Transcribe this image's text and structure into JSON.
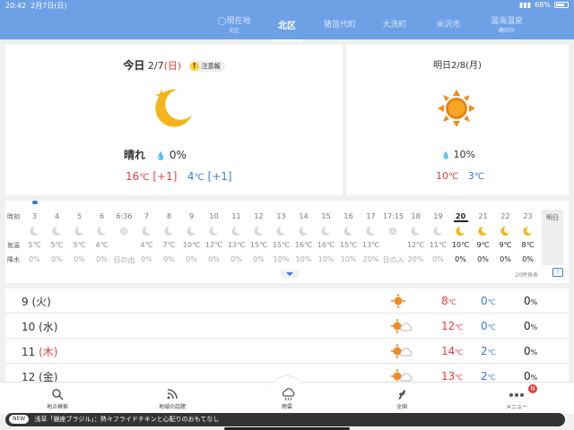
{
  "status": {
    "time": "20:42",
    "date": "2月7日(日)",
    "battery": "68%"
  },
  "locations": [
    {
      "label": "◯現在地",
      "sub": "北区"
    },
    {
      "label": "北区",
      "sub": ""
    },
    {
      "label": "猪苗代町",
      "sub": ""
    },
    {
      "label": "大洗町",
      "sub": ""
    },
    {
      "label": "米沢市",
      "sub": ""
    },
    {
      "label": "温海温泉",
      "sub": "鶴岡市"
    }
  ],
  "today": {
    "label": "今日",
    "date": "2/7",
    "dow": "(日)",
    "warning": "注意報",
    "condition": "晴れ",
    "rain": "0%",
    "high": "16",
    "high_diff": "[+1]",
    "low": "4",
    "low_diff": "[+1]",
    "unit": "℃"
  },
  "tomorrow": {
    "label": "明日2/8(月)",
    "rain": "10%",
    "high": "10",
    "low": "3",
    "unit": "℃"
  },
  "hourly_labels": {
    "hour": "時刻",
    "temp": "気温",
    "rain": "降水"
  },
  "hourly": [
    {
      "h": "3",
      "t": "5℃",
      "r": "0%",
      "icon": "moon-icon"
    },
    {
      "h": "4",
      "t": "5℃",
      "r": "0%",
      "icon": "moon-icon"
    },
    {
      "h": "5",
      "t": "5℃",
      "r": "0%",
      "icon": "moon-icon"
    },
    {
      "h": "6",
      "t": "4℃",
      "r": "0%",
      "icon": "moon-icon"
    },
    {
      "h": "6:36",
      "t": "",
      "r": "日の出",
      "icon": "sunrise-icon"
    },
    {
      "h": "7",
      "t": "4℃",
      "r": "0%",
      "icon": "moon-icon"
    },
    {
      "h": "8",
      "t": "7℃",
      "r": "0%",
      "icon": "moon-icon"
    },
    {
      "h": "9",
      "t": "10℃",
      "r": "0%",
      "icon": "moon-icon"
    },
    {
      "h": "10",
      "t": "12℃",
      "r": "0%",
      "icon": "moon-icon"
    },
    {
      "h": "11",
      "t": "13℃",
      "r": "0%",
      "icon": "moon-icon"
    },
    {
      "h": "12",
      "t": "15℃",
      "r": "0%",
      "icon": "moon-icon"
    },
    {
      "h": "13",
      "t": "15℃",
      "r": "10%",
      "icon": "moon-icon"
    },
    {
      "h": "14",
      "t": "16℃",
      "r": "10%",
      "icon": "moon-icon"
    },
    {
      "h": "15",
      "t": "16℃",
      "r": "10%",
      "icon": "moon-icon"
    },
    {
      "h": "16",
      "t": "15℃",
      "r": "10%",
      "icon": "moon-icon"
    },
    {
      "h": "17",
      "t": "13℃",
      "r": "20%",
      "icon": "moon-icon"
    },
    {
      "h": "17:15",
      "t": "",
      "r": "日の入",
      "icon": "sunset-icon"
    },
    {
      "h": "18",
      "t": "12℃",
      "r": "20%",
      "icon": "moon-icon"
    },
    {
      "h": "19",
      "t": "11℃",
      "r": "0%",
      "icon": "moon-icon"
    },
    {
      "h": "20",
      "t": "10℃",
      "r": "0%",
      "icon": "moon-icon",
      "now": true
    },
    {
      "h": "21",
      "t": "9℃",
      "r": "0%",
      "icon": "moon-icon"
    },
    {
      "h": "22",
      "t": "9℃",
      "r": "0%",
      "icon": "moon-icon"
    },
    {
      "h": "23",
      "t": "8℃",
      "r": "0%",
      "icon": "moon-icon"
    }
  ],
  "hourly_tomorrow": "明日",
  "published": "20時発表",
  "weekly": [
    {
      "day": "9",
      "dow": "(火)",
      "dow_red": false,
      "icon": "sun-icon",
      "high": "8",
      "low": "0",
      "rain": "0",
      "unit": "℃",
      "pct": "%"
    },
    {
      "day": "10",
      "dow": "(水)",
      "dow_red": false,
      "icon": "sun-cloud-icon",
      "high": "12",
      "low": "0",
      "rain": "0",
      "unit": "℃",
      "pct": "%"
    },
    {
      "day": "11",
      "dow": "(木)",
      "dow_red": true,
      "icon": "sun-cloud-icon",
      "high": "14",
      "low": "2",
      "rain": "0",
      "unit": "℃",
      "pct": "%"
    },
    {
      "day": "12",
      "dow": "(金)",
      "dow_red": false,
      "icon": "sun-cloud-icon",
      "high": "13",
      "low": "2",
      "rain": "0",
      "unit": "℃",
      "pct": "%"
    }
  ],
  "tabs": [
    {
      "label": "地点検索",
      "icon": "search-icon"
    },
    {
      "label": "地域の話題",
      "icon": "rss-icon"
    },
    {
      "label": "雨雲",
      "icon": "rain-cloud-icon"
    },
    {
      "label": "全国",
      "icon": "map-icon"
    },
    {
      "label": "メニュー",
      "icon": "menu-icon",
      "badge": "N"
    }
  ],
  "ticker": {
    "new": "NEW",
    "text": "浅草「銀座ブラジル」：熱々フライドチキンと心配りのおもてなし"
  },
  "colors": {
    "header": "#6ea0e6",
    "high": "#e63c3c",
    "low": "#3a7bd5",
    "sun": "#f08a1c",
    "moon": "#f5b41c"
  }
}
